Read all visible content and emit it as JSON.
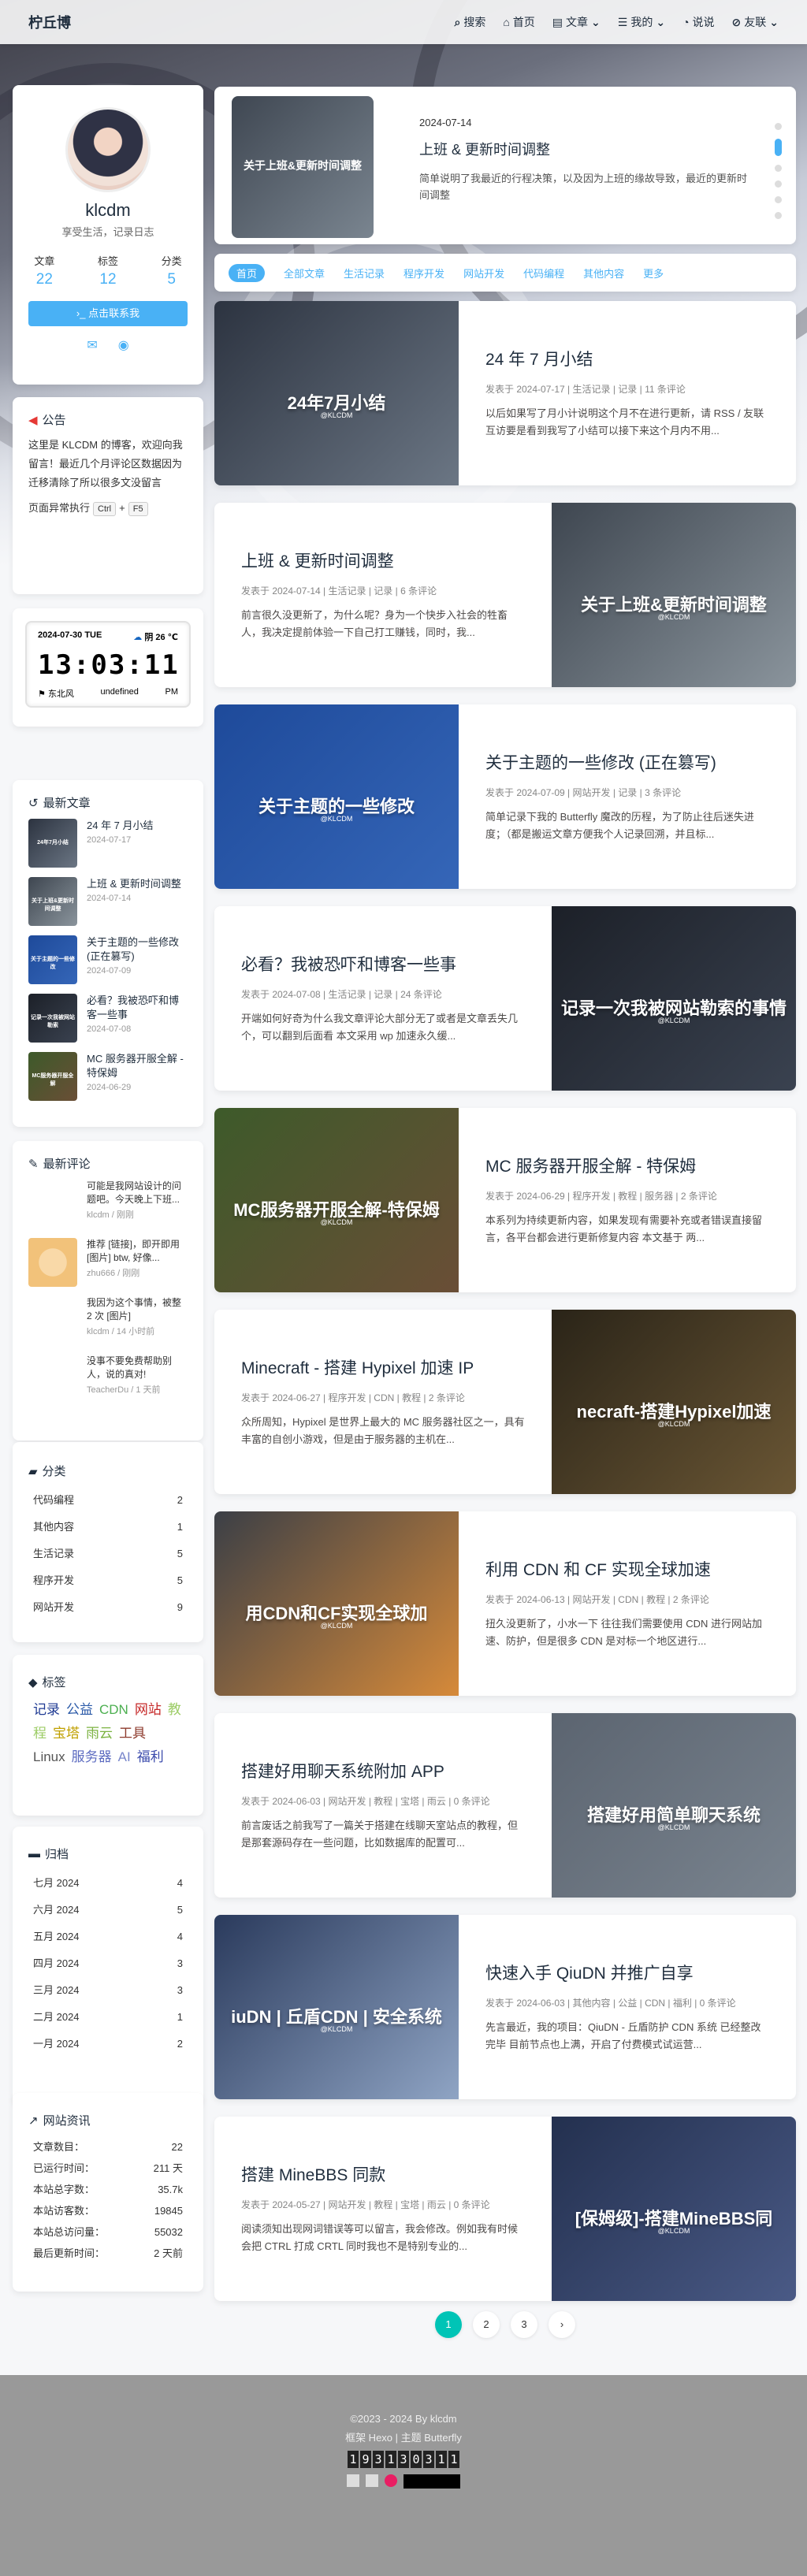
{
  "nav": {
    "brand": "柠丘博",
    "items": [
      "搜索",
      "首页",
      "文章",
      "我的",
      "说说",
      "友联"
    ]
  },
  "profile": {
    "name": "klcdm",
    "desc": "享受生活，记录日志",
    "stats": [
      {
        "label": "文章",
        "value": "22"
      },
      {
        "label": "标签",
        "value": "12"
      },
      {
        "label": "分类",
        "value": "5"
      }
    ],
    "follow": "点击联系我"
  },
  "announce": {
    "title": "公告",
    "body": "这里是 KLCDM 的博客，欢迎向我留言！最近几个月评论区数据因为迁移清除了所以很多文没留言",
    "exec_prefix": "页面异常执行",
    "key1": "Ctrl",
    "plus": "+",
    "key2": "F5"
  },
  "clock": {
    "date": "2024-07-30 TUE",
    "weather": "阴 26 ℃",
    "time": "13:03:11",
    "wind": "东北风",
    "city": "undefined",
    "ampm": "PM"
  },
  "recent": {
    "title": "最新文章",
    "items": [
      {
        "title": "24 年 7 月小结",
        "date": "2024-07-17",
        "thumb": "24年7月小结"
      },
      {
        "title": "上班 & 更新时间调整",
        "date": "2024-07-14",
        "thumb": "关于上班&更新时间调整"
      },
      {
        "title": "关于主题的一些修改 (正在篡写)",
        "date": "2024-07-09",
        "thumb": "关于主题的一些修改"
      },
      {
        "title": "必看？我被恐吓和博客一些事",
        "date": "2024-07-08",
        "thumb": "记录一次我被网站勒索"
      },
      {
        "title": "MC 服务器开服全解 - 特保姆",
        "date": "2024-06-29",
        "thumb": "MC服务器开服全解"
      }
    ]
  },
  "comments": {
    "title": "最新评论",
    "items": [
      {
        "text": "可能是我网站设计的问题吧。今天晚上下班...",
        "meta": "klcdm / 刚刚"
      },
      {
        "text": "推荐 [链接]，即开即用 [图片] btw, 好像...",
        "meta": "zhu666 / 刚刚"
      },
      {
        "text": "我因为这个事情，被整 2 次 [图片]",
        "meta": "klcdm / 14 小时前"
      },
      {
        "text": "没事不要免费帮助别人，说的真对!",
        "meta": "TeacherDu / 1 天前"
      }
    ]
  },
  "categories": {
    "title": "分类",
    "items": [
      {
        "name": "代码编程",
        "count": "2"
      },
      {
        "name": "其他内容",
        "count": "1"
      },
      {
        "name": "生活记录",
        "count": "5"
      },
      {
        "name": "程序开发",
        "count": "5"
      },
      {
        "name": "网站开发",
        "count": "9"
      }
    ]
  },
  "tags": {
    "title": "标签",
    "items": [
      {
        "name": "记录",
        "color": "#1f3a93"
      },
      {
        "name": "公益",
        "color": "#2b5aa8"
      },
      {
        "name": "CDN",
        "color": "#4caf50"
      },
      {
        "name": "网站",
        "color": "#c62828"
      },
      {
        "name": "教程",
        "color": "#9ccc65"
      },
      {
        "name": "宝塔",
        "color": "#c0a000"
      },
      {
        "name": "雨云",
        "color": "#7cb342"
      },
      {
        "name": "工具",
        "color": "#8d3a2c"
      },
      {
        "name": "Linux",
        "color": "#555"
      },
      {
        "name": "服务器",
        "color": "#5c6bc0"
      },
      {
        "name": "AI",
        "color": "#7986cb"
      },
      {
        "name": "福利",
        "color": "#3949ab"
      }
    ]
  },
  "archive": {
    "title": "归档",
    "items": [
      {
        "name": "七月 2024",
        "count": "4"
      },
      {
        "name": "六月 2024",
        "count": "5"
      },
      {
        "name": "五月 2024",
        "count": "4"
      },
      {
        "name": "四月 2024",
        "count": "3"
      },
      {
        "name": "三月 2024",
        "count": "3"
      },
      {
        "name": "二月 2024",
        "count": "1"
      },
      {
        "name": "一月 2024",
        "count": "2"
      }
    ]
  },
  "siteinfo": {
    "title": "网站资讯",
    "items": [
      {
        "name": "文章数目：",
        "value": "22"
      },
      {
        "name": "已运行时间：",
        "value": "211 天"
      },
      {
        "name": "本站总字数：",
        "value": "35.7k"
      },
      {
        "name": "本站访客数：",
        "value": "19845"
      },
      {
        "name": "本站总访问量：",
        "value": "55032"
      },
      {
        "name": "最后更新时间：",
        "value": "2 天前"
      }
    ]
  },
  "feature": {
    "date": "2024-07-14",
    "title": "上班 & 更新时间调整",
    "desc": "简单说明了我最近的行程决策，以及因为上班的缘故导致，最近的更新时间调整",
    "thumb": "关于上班&更新时间调整"
  },
  "cats_bar": [
    "首页",
    "全部文章",
    "生活记录",
    "程序开发",
    "网站开发",
    "代码编程",
    "其他内容",
    "更多"
  ],
  "posts": [
    {
      "title": "24 年 7 月小结",
      "meta": "发表于 2024-07-17 | 生活记录 | 记录 | 11 条评论",
      "desc": "以后如果写了月小计说明这个月不在进行更新，请 RSS / 友联互访要是看到我写了小结可以接下来这个月内不用...",
      "thumb": "24年7月小结",
      "c1": "#2c3340",
      "c2": "#6b7684"
    },
    {
      "title": "上班 & 更新时间调整",
      "meta": "发表于 2024-07-14 | 生活记录 | 记录 | 6 条评论",
      "desc": "前言很久没更新了，为什么呢？身为一个快步入社会的牲畜人，我决定提前体验一下自己打工赚钱，同时，我...",
      "thumb": "关于上班&更新时间调整",
      "c1": "#3e4650",
      "c2": "#8a949c"
    },
    {
      "title": "关于主题的一些修改 (正在篡写)",
      "meta": "发表于 2024-07-09 | 网站开发 | 记录 | 3 条评论",
      "desc": "简单记录下我的 Butterfly 魔改的历程，为了防止往后迷失进度；（都是搬运文章方便我个人记录回溯，并且标...",
      "thumb": "关于主题的一些修改",
      "c1": "#1e4a9a",
      "c2": "#3566b8"
    },
    {
      "title": "必看？我被恐吓和博客一些事",
      "meta": "发表于 2024-07-08 | 生活记录 | 记录 | 24 条评论",
      "desc": "开端如何好奇为什么我文章评论大部分无了或者是文章丢失几个，可以翻到后面看 本文采用 wp 加速永久缓...",
      "thumb": "记录一次我被网站勒索的事情",
      "c1": "#1c2028",
      "c2": "#3a4250"
    },
    {
      "title": "MC 服务器开服全解 - 特保姆",
      "meta": "发表于 2024-06-29 | 程序开发 | 教程 | 服务器 | 2 条评论",
      "desc": "本系列为持续更新内容，如果发现有需要补充或者错误直接留言，各平台都会进行更新修复内容 本文基于 两...",
      "thumb": "MC服务器开服全解-特保姆",
      "c1": "#3d5a2a",
      "c2": "#6a4e36"
    },
    {
      "title": "Minecraft - 搭建 Hypixel 加速 IP",
      "meta": "发表于 2024-06-27 | 程序开发 | CDN | 教程 | 2 条评论",
      "desc": "众所周知，Hypixel 是世界上最大的 MC 服务器社区之一，具有丰富的自创小游戏，但是由于服务器的主机在...",
      "thumb": "necraft-搭建Hypixel加速",
      "c1": "#2a2418",
      "c2": "#6a5634"
    },
    {
      "title": "利用 CDN 和 CF 实现全球加速",
      "meta": "发表于 2024-06-13 | 网站开发 | CDN | 教程 | 2 条评论",
      "desc": "扭久没更新了，小水一下 往往我们需要使用 CDN 进行网站加速、防护，但是很多 CDN 是对标一个地区进行...",
      "thumb": "用CDN和CF实现全球加",
      "c1": "#3b3f46",
      "c2": "#d68a3a"
    },
    {
      "title": "搭建好用聊天系统附加 APP",
      "meta": "发表于 2024-06-03 | 网站开发 | 教程 | 宝塔 | 雨云 | 0 条评论",
      "desc": "前言废话之前我写了一篇关于搭建在线聊天室站点的教程，但是那套源码存在一些问题，比如数据库的配置可...",
      "thumb": "搭建好用简单聊天系统",
      "c1": "#5b6470",
      "c2": "#7a848f"
    },
    {
      "title": "快速入手 QiuDN 并推广自享",
      "meta": "发表于 2024-06-03 | 其他内容 | 公益 | CDN | 福利 | 0 条评论",
      "desc": "先言最近，我的项目：QiuDN - 丘盾防护 CDN 系统 已经整改完毕 目前节点也上满，开启了付费模式试运营...",
      "thumb": "iuDN | 丘盾CDN | 安全系统",
      "c1": "#2a3a5c",
      "c2": "#8fa4c4"
    },
    {
      "title": "搭建 MineBBS 同款",
      "meta": "发表于 2024-05-27 | 网站开发 | 教程 | 宝塔 | 雨云 | 0 条评论",
      "desc": "阅读须知出现网词错误等可以留言，我会修改。例如我有时候会把 CTRL 打成 CRTL 同时我也不是特别专业的...",
      "thumb": "[保姆级]-搭建MineBBS同",
      "c1": "#23304f",
      "c2": "#4a5a86"
    }
  ],
  "pager": [
    "1",
    "2",
    "3",
    "›"
  ],
  "footer": {
    "copy": "©2023 - 2024 By klcdm",
    "theme": "框架 Hexo | 主题 Butterfly",
    "counter": [
      "1",
      "9",
      "3",
      "1",
      "3",
      "0",
      "3",
      "1",
      "1"
    ]
  }
}
